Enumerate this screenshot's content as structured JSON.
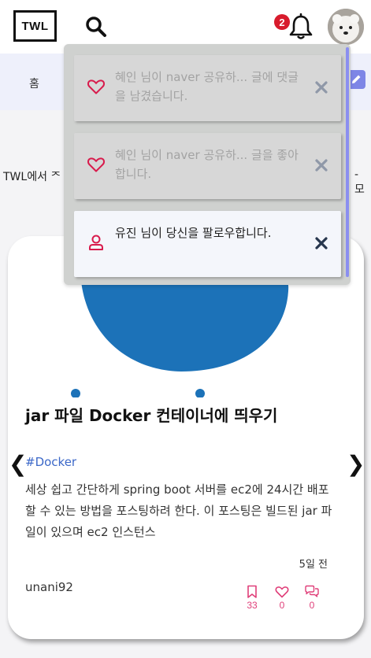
{
  "header": {
    "logo": "TWL",
    "search_icon": "search-icon",
    "notification_icon": "bell-icon",
    "notification_count": "2",
    "avatar_icon": "avatar"
  },
  "nav": {
    "home_label": "홈",
    "edit_icon": "pencil-icon"
  },
  "intro": {
    "text": "TWL에서 ᄌ",
    "text_right": "- 모"
  },
  "notifications": [
    {
      "type": "like",
      "icon": "heart-icon",
      "text": "혜인 님이 naver 공유하... 글에 댓글을 남겼습니다.",
      "read": true
    },
    {
      "type": "like",
      "icon": "heart-icon",
      "text": "혜인 님이 naver 공유하... 글을 좋아합니다.",
      "read": true
    },
    {
      "type": "follow",
      "icon": "user-icon",
      "text": "유진 님이 당신을 팔로우합니다.",
      "read": false
    }
  ],
  "card": {
    "title": "jar 파일 Docker 컨테이너에 띄우기",
    "tag": "#Docker",
    "excerpt": "세상 쉽고 간단하게 spring boot 서버를 ec2에 24시간 배포할 수 있는 방법을 포스팅하려 한다. 이 포스팅은 빌드된 jar 파일이 있으며 ec2 인스턴스",
    "date": "5일 전",
    "author": "unani92",
    "bookmarks": "33",
    "likes": "0",
    "comments": "0"
  },
  "carousel": {
    "prev": "❮",
    "next": "❯"
  },
  "colors": {
    "accent": "#7e86e6",
    "badge": "#d81b2c",
    "tag": "#3c68c8",
    "stat": "#e0407a",
    "docker_blue": "#1c72b8"
  }
}
